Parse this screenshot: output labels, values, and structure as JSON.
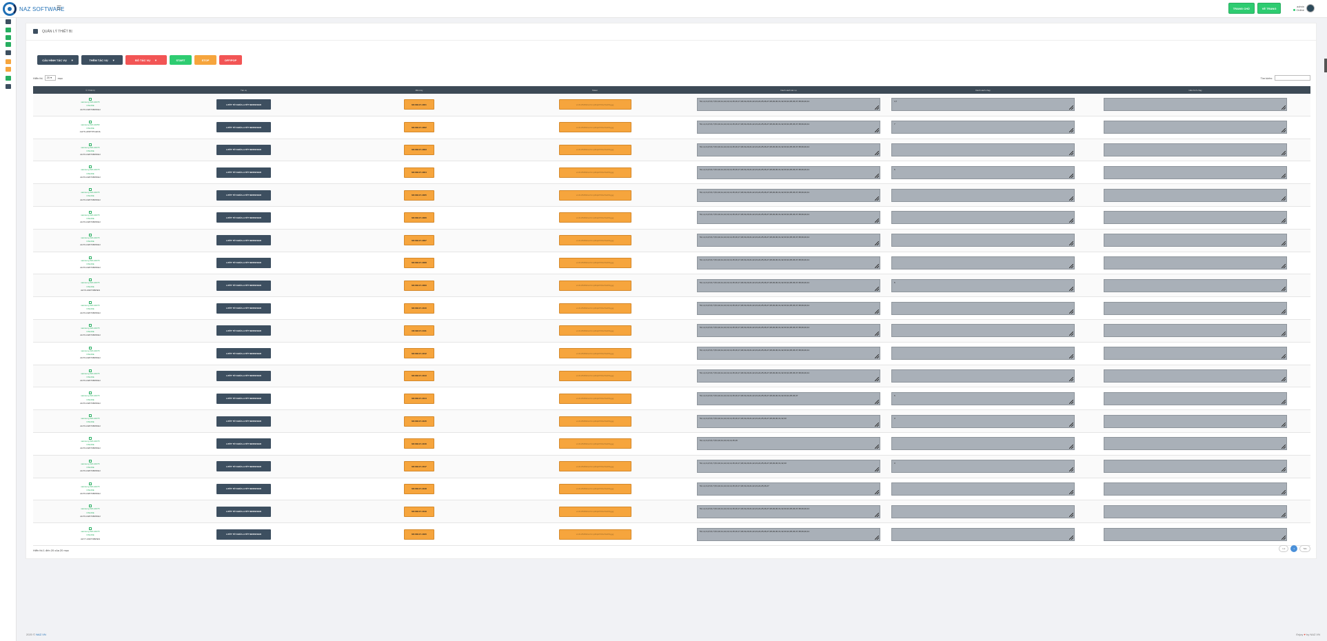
{
  "brand": {
    "name": "NAZ SOFTWARE",
    "menu_icon": "hamburger-icon"
  },
  "top_buttons": [
    "TRANG CHỦ",
    "VỀ TRANG"
  ],
  "user": {
    "name": "admin",
    "status": "Online"
  },
  "sidebar_icons": [
    {
      "name": "dashboard-icon",
      "color": "#3d4f60"
    },
    {
      "name": "sheet-icon",
      "color": "#27ae60"
    },
    {
      "name": "sheet-add-icon",
      "color": "#27ae60"
    },
    {
      "name": "sheet-edit-icon",
      "color": "#27ae60"
    },
    {
      "name": "key-icon",
      "color": "#3d4f60"
    },
    {
      "name": "user-icon",
      "color": "#f6a53d"
    },
    {
      "name": "bank-icon",
      "color": "#f6a53d"
    },
    {
      "name": "card-icon",
      "color": "#27ae60"
    },
    {
      "name": "monitor-icon",
      "color": "#3d4f60"
    }
  ],
  "page": {
    "title": "QUẢN LÝ THIẾT BỊ"
  },
  "toolbar": {
    "config_label": "CẤU HÌNH TÁC VỤ",
    "add_label": "THÊM TÁC VỤ",
    "remove_label": "BỎ TÁC VỤ",
    "start_label": "START",
    "stop_label": "STOP",
    "off_label": "OFF/POP"
  },
  "table_controls": {
    "show_label": "Hiển thị",
    "show_value": "20",
    "show_suffix": "mục",
    "search_label": "Tìm kiếm:"
  },
  "columns": [
    "Thiết bị",
    "Tác vụ",
    "Mã máy",
    "Token",
    "Danh sách tác vụ",
    "Danh sách chạy",
    "Cấu hình chạy"
  ],
  "rows": [
    {
      "name": "samsung SM-A107F",
      "status": "ONLINE",
      "serial": "AHY6-LWDT4BWFEU",
      "task_btn": "LƯỚT TỚ KHÓA-LƯỚT NEWSFEED",
      "code": "NZ-SM-17-4401",
      "token": "vmFt-8MtWkwVzmpMqE7K8wr9wDSggg",
      "tasks": "51,1,2,3,4,5,6,7,8,9,10,11,12,13,14,15,16,17,18,19,20,21,22,23,24,25,26,27,28,29,30,31,32,33,34,35,36,37,38,39,40,41",
      "run": "4,7",
      "config": ""
    },
    {
      "name": "samsung SM-A105F",
      "status": "ONLINE",
      "serial": "AHY6-LWDT9TGEOJL",
      "task_btn": "LƯỚT TỚ KHÓA-LƯỚT NEWSFEED",
      "code": "NZ-SM-17-4402",
      "token": "vmFt-8MtWkwVzmpMqE7K8wr9wDSggg",
      "tasks": "51,1,2,3,4,5,6,7,8,9,10,11,12,13,14,15,16,17,18,19,20,21,22,23,24,25,26,27,28,29,30,31,32,33,34,35,36,37,38,39,40,41",
      "run": "7",
      "config": ""
    },
    {
      "name": "samsung SM-A107F",
      "status": "ONLINE",
      "serial": "AHY6-LWDT4BWFEU",
      "task_btn": "LƯỚT TỚ KHÓA-LƯỚT NEWSFEED",
      "code": "NZ-SM-17-4403",
      "token": "vmFt-8MtWkwVzmpMqE7K8wr9wDSggg",
      "tasks": "51,1,2,3,4,5,6,7,8,9,10,11,12,13,14,15,16,17,18,19,20,21,22,23,24,25,26,27,28,29,30,31,32,33,34,35,36,37,38,39,40,41",
      "run": "",
      "config": ""
    },
    {
      "name": "samsung SM-A107F",
      "status": "ONLINE",
      "serial": "AHY6-LWDT4BWFEU",
      "task_btn": "LƯỚT TỚ KHÓA-LƯỚT NEWSFEED",
      "code": "NZ-SM-17-4404",
      "token": "vmFt-8MtWkwVzmpMqE7K8wr9wDSggg",
      "tasks": "51,1,2,3,4,5,6,7,8,9,10,11,12,13,14,15,16,17,18,19,20,21,22,23,24,25,26,27,28,29,30,31,32,33,34,35,36,37,38,39,40,41",
      "run": "6",
      "config": ""
    },
    {
      "name": "samsung SM-A107F",
      "status": "ONLINE",
      "serial": "AHY6-LWDT4BWFEU",
      "task_btn": "LƯỚT TỚ KHÓA-LƯỚT NEWSFEED",
      "code": "NZ-SM-17-4405",
      "token": "vmFt-8MtWkwVzmpMqE7K8wr9wDSggg",
      "tasks": "51,1,2,3,4,5,6,7,8,9,10,11,12,13,14,15,16,17,18,19,20,21,22,23,24,25,26,27,28,29,30,31,32,33,34,35,36,37,38,39,40,41",
      "run": "",
      "config": ""
    },
    {
      "name": "samsung SM-A107F",
      "status": "ONLINE",
      "serial": "AHY6-LWDT4BWFEU",
      "task_btn": "LƯỚT TỚ KHÓA-LƯỚT NEWSFEED",
      "code": "NZ-SM-17-4406",
      "token": "vmFt-8MtWkwVzmpMqE7K8wr9wDSggg",
      "tasks": "51,1,2,3,4,5,6,7,8,9,10,11,12,13,14,15,16,17,18,19,20,21,22,23,24,25,26,27,28,29,30,31,32,33,34,35,36,37,38,39,40,41",
      "run": "",
      "config": ""
    },
    {
      "name": "samsung SM-A107F",
      "status": "ONLINE",
      "serial": "AHY6-LWDT4BWFEU",
      "task_btn": "LƯỚT TỚ KHÓA-LƯỚT NEWSFEED",
      "code": "NZ-SM-17-4407",
      "token": "vmFt-8MtWkwVzmpMqE7K8wr9wDSggg",
      "tasks": "51,1,2,3,4,5,6,7,8,9,10,11,12,13,14,15,16,17,18,19,20,21,22,23,24,25,26,27,28,29,30,31,32,33,34,35,36,37,38,39,40,41",
      "run": "",
      "config": ""
    },
    {
      "name": "samsung SM-A107F",
      "status": "ONLINE",
      "serial": "AHY6-LWDT4BWFEU",
      "task_btn": "LƯỚT TỚ KHÓA-LƯỚT NEWSFEED",
      "code": "NZ-SM-17-4408",
      "token": "vmFt-8MtWkwVzmpMqE7K8wr9wDSggg",
      "tasks": "51,1,2,3,4,5,6,7,8,9,10,11,12,13,14,15,16,17,18,19,20,21,22,23,24,25,26,27,28,29,30,31,32,33,34,35,36,37,38,39,40,41",
      "run": "",
      "config": ""
    },
    {
      "name": "samsung SM-A107F",
      "status": "ONLINE",
      "serial": "AHY6-LWDT4BWEN",
      "task_btn": "LƯỚT TỚ KHÓA-LƯỚT NEWSFEED",
      "code": "NZ-SM-17-4409",
      "token": "vmFt-8MtWkwVzmpMqE7K8wr9wDSggg",
      "tasks": "51,1,2,3,4,5,6,7,8,9,10,11,12,13,14,15,16,17,18,19,20,21,22,23,24,25,26,27,28,29,30,31,32,33,34,35,36,37,38,39,40,41",
      "run": "6",
      "config": ""
    },
    {
      "name": "samsung SM-A107F",
      "status": "ONLINE",
      "serial": "AHY6-LWDT4BWFEU",
      "task_btn": "LƯỚT TỚ KHÓA-LƯỚT NEWSFEED",
      "code": "NZ-SM-17-4410",
      "token": "vmFt-8MtWkwVzmpMqE7K8wr9wDSggg",
      "tasks": "51,1,2,3,4,5,6,7,8,9,10,11,12,13,14,15,16,17,18,19,20,21,22,23,24,25,26,27,28,29,30,31,32,33,34,35,36,37,38,39,40,41",
      "run": "",
      "config": ""
    },
    {
      "name": "samsung SM-A107F",
      "status": "ONLINE",
      "serial": "AHY6-LWDT4BWFEU",
      "task_btn": "LƯỚT TỚ KHÓA-LƯỚT NEWSFEED",
      "code": "NZ-SM-17-4411",
      "token": "vmFt-8MtWkwVzmpMqE7K8wr9wDSggg",
      "tasks": "51,1,2,3,4,5,6,7,8,9,10,11,12,13,14,15,16,17,18,19,20,21,22,23,24,25,26,27,28,29,30,31,32,33,34,35,36,37,38,39,40,41",
      "run": "",
      "config": ""
    },
    {
      "name": "samsung SM-A107F",
      "status": "ONLINE",
      "serial": "AHY6-LWDT4BWFEU",
      "task_btn": "LƯỚT TỚ KHÓA-LƯỚT NEWSFEED",
      "code": "NZ-SM-17-4412",
      "token": "vmFt-8MtWkwVzmpMqE7K8wr9wDSggg",
      "tasks": "51,1,2,3,4,5,6,7,8,9,10,11,12,13,14,15,16,17,18,19,20,21,22,23,24,25,26,27,28,29,30,31,32,33,34,35,36,37,38,39,40,41",
      "run": "",
      "config": ""
    },
    {
      "name": "samsung SM-A107F",
      "status": "ONLINE",
      "serial": "AHY6-LWDT4BWFEU",
      "task_btn": "LƯỚT TỚ KHÓA-LƯỚT NEWSFEED",
      "code": "NZ-SM-17-4413",
      "token": "vmFt-8MtWkwVzmpMqE7K8wr9wDSggg",
      "tasks": "51,1,2,3,4,5,6,7,8,9,10,11,12,13,14,15,16,17,18,19,20,21,22,23,24,25,26,27,28,29,30,31,32,33,34,35,36,37,38,39,40,41",
      "run": "",
      "config": ""
    },
    {
      "name": "samsung SM-A107F",
      "status": "ONLINE",
      "serial": "AHY6-LWDT4BWFEU",
      "task_btn": "LƯỚT TỚ KHÓA-LƯỚT NEWSFEED",
      "code": "NZ-SM-17-4414",
      "token": "vmFt-8MtWkwVzmpMqE7K8wr9wDSggg",
      "tasks": "51,1,2,3,4,5,6,7,8,9,10,11,12,13,14,15,16,17,18,19,20,21,22,23,24,25,26,27,28,29,30,31,32,33,34,35,36,37",
      "run": "6",
      "config": ""
    },
    {
      "name": "samsung SM-A107F",
      "status": "ONLINE",
      "serial": "AHY6-LWDT4BWFEU",
      "task_btn": "LƯỚT TỚ KHÓA-LƯỚT NEWSFEED",
      "code": "NZ-SM-17-4415",
      "token": "vmFt-8MtWkwVzmpMqE7K8wr9wDSggg",
      "tasks": "51,1,2,3,4,5,6,7,8,9,10,11,12,13,14,15,16,17,18,19,20,21,22,23,24,25,26,27,28,29,30,31,32,33",
      "run": "3",
      "config": ""
    },
    {
      "name": "samsung SM-A107F",
      "status": "ONLINE",
      "serial": "AHY6-LWDT4BWFEU",
      "task_btn": "LƯỚT TỚ KHÓA-LƯỚT NEWSFEED",
      "code": "NZ-SM-17-4416",
      "token": "vmFt-8MtWkwVzmpMqE7K8wr9wDSggg",
      "tasks": "51,1,2,3,4,5,6,7,8,9,10,11,12,13,14,15,16",
      "run": "",
      "config": ""
    },
    {
      "name": "samsung SM-A107F",
      "status": "ONLINE",
      "serial": "AHY6-LWDT4BWFEU",
      "task_btn": "LƯỚT TỚ KHÓA-LƯỚT NEWSFEED",
      "code": "NZ-SM-17-4417",
      "token": "vmFt-8MtWkwVzmpMqE7K8wr9wDSggg",
      "tasks": "51,1,2,3,4,5,6,7,8,9,10,11,12,13,14,15,16,17,18,19,20,21,22,23,24,25,26,27,28,29,30,31,32,33",
      "run": "3",
      "config": ""
    },
    {
      "name": "samsung SM-A107F",
      "status": "ONLINE",
      "serial": "AHY6-LWDT4BWFEU",
      "task_btn": "LƯỚT TỚ KHÓA-LƯỚT NEWSFEED",
      "code": "NZ-SM-17-4418",
      "token": "vmFt-8MtWkwVzmpMqE7K8wr9wDSggg",
      "tasks": "51,1,2,3,4,5,6,7,8,9,10,11,12,13,14,15,16,17,18,19,20,21,22,23,24,25,26,27",
      "run": "",
      "config": ""
    },
    {
      "name": "samsung SM-A107F",
      "status": "ONLINE",
      "serial": "AHY6-LWDT4BWFEU",
      "task_btn": "LƯỚT TỚ KHÓA-LƯỚT NEWSFEED",
      "code": "NZ-SM-17-4419",
      "token": "vmFt-8MtWkwVzmpMqE7K8wr9wDSggg",
      "tasks": "51,1,2,3,4,5,6,7,8,9,10,11,12,13,14,15,16,17,18,19,20,21,22,23,24,25,26,27,28,29,30,31,32,33,34,35,36,37,38,39,40,41",
      "run": "",
      "config": ""
    },
    {
      "name": "samsung SM-A107F",
      "status": "ONLINE",
      "serial": "AHY7-LWDT4BWEN",
      "task_btn": "LƯỚT TỚ KHÓA-LƯỚT NEWSFEED",
      "code": "NZ-SM-17-4420",
      "token": "vmFt-8MtWkwVzmpMqE7K8wr9wDSggg",
      "tasks": "51,1,2,3,4,5,6,7,8,9,10,11,12,13,14,15,16,17,18,19,20,21,22,23,24,25,26,27,28,29,30,31,32,33,34,35,36,37,38,39,40,41",
      "run": "",
      "config": ""
    }
  ],
  "table_info": "Hiển thị 1 đến 20 của 20 mục",
  "pagination": {
    "prev": "Lùi",
    "current": "1",
    "next": "Tiến"
  },
  "footer": {
    "year": "2020 ©",
    "brand": "NAZ.VN",
    "right_prefix": "Enjoy",
    "right_suffix": "by NAZ.VN"
  }
}
